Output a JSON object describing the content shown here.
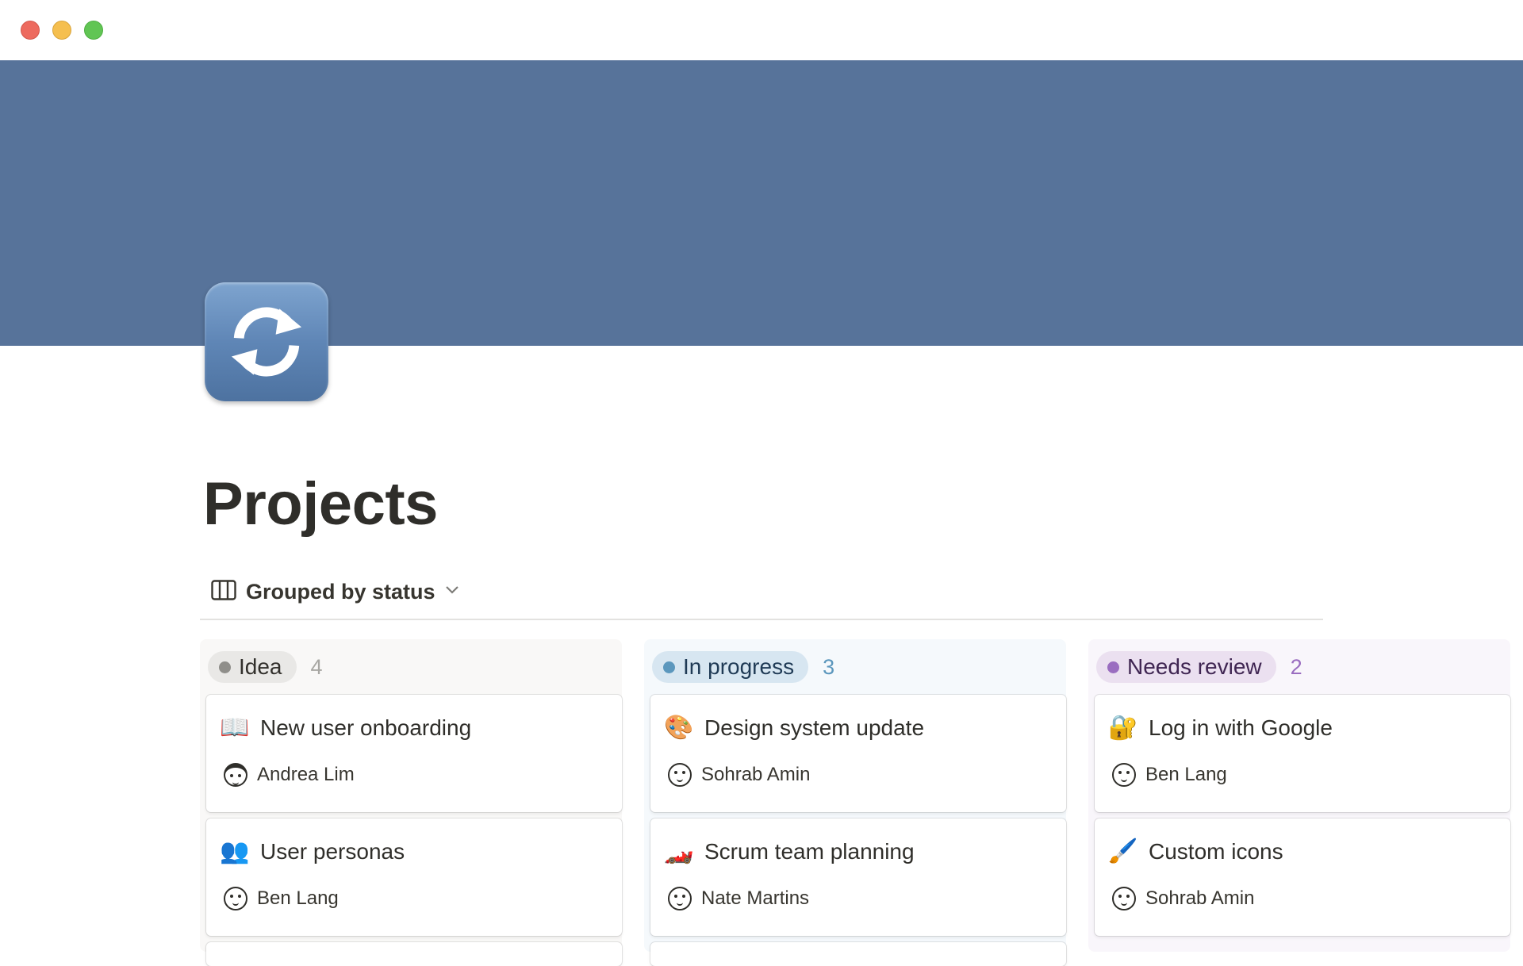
{
  "window": {
    "traffic_lights": [
      "close",
      "minimize",
      "zoom"
    ]
  },
  "page": {
    "icon": "arrows-counterclockwise-icon",
    "title": "Projects",
    "cover_color": "#57739a"
  },
  "view": {
    "icon": "board-view-icon",
    "label": "Grouped by status",
    "dropdown_icon": "chevron-down-icon"
  },
  "columns": [
    {
      "status": "Idea",
      "count": "4",
      "color": "#8f8e8a",
      "cards": [
        {
          "emoji": "📖",
          "icon": "open-book-icon",
          "title": "New user onboarding",
          "assignee": "Andrea Lim"
        },
        {
          "emoji": "👥",
          "icon": "busts-icon",
          "title": "User personas",
          "assignee": "Ben Lang"
        }
      ]
    },
    {
      "status": "In progress",
      "count": "3",
      "color": "#5b97bd",
      "cards": [
        {
          "emoji": "🎨",
          "icon": "palette-icon",
          "title": "Design system update",
          "assignee": "Sohrab Amin"
        },
        {
          "emoji": "🏎️",
          "icon": "race-car-icon",
          "title": "Scrum team planning",
          "assignee": "Nate Martins"
        }
      ]
    },
    {
      "status": "Needs review",
      "count": "2",
      "color": "#9a6dc0",
      "cards": [
        {
          "emoji": "🔐",
          "icon": "lock-with-key-icon",
          "title": "Log in with Google",
          "assignee": "Ben Lang"
        },
        {
          "emoji": "🖌️",
          "icon": "paintbrush-icon",
          "title": "Custom icons",
          "assignee": "Sohrab Amin"
        }
      ]
    }
  ]
}
